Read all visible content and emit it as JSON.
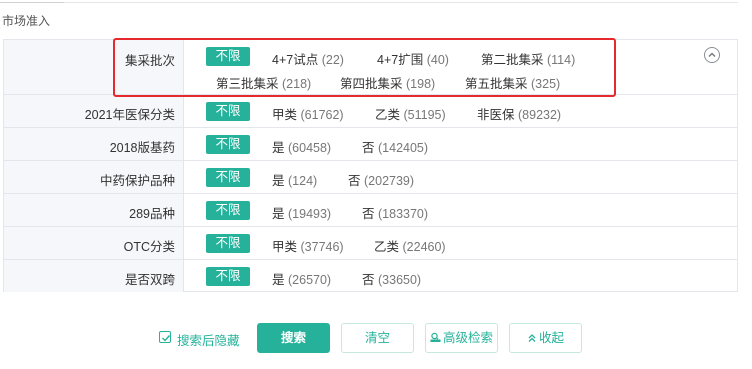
{
  "section": {
    "title": "市场准入"
  },
  "filters": [
    {
      "label": "集采批次",
      "unlimited": "不限",
      "options": [
        {
          "name": "4+7试点",
          "count": "(22)"
        },
        {
          "name": "4+7扩围",
          "count": "(40)"
        },
        {
          "name": "第二批集采",
          "count": "(114)"
        },
        {
          "name": "第三批集采",
          "count": "(218)"
        },
        {
          "name": "第四批集采",
          "count": "(198)"
        },
        {
          "name": "第五批集采",
          "count": "(325)"
        }
      ]
    },
    {
      "label": "2021年医保分类",
      "unlimited": "不限",
      "options": [
        {
          "name": "甲类",
          "count": "(61762)"
        },
        {
          "name": "乙类",
          "count": "(51195)"
        },
        {
          "name": "非医保",
          "count": "(89232)"
        }
      ]
    },
    {
      "label": "2018版基药",
      "unlimited": "不限",
      "options": [
        {
          "name": "是",
          "count": "(60458)"
        },
        {
          "name": "否",
          "count": "(142405)"
        }
      ]
    },
    {
      "label": "中药保护品种",
      "unlimited": "不限",
      "options": [
        {
          "name": "是",
          "count": "(124)"
        },
        {
          "name": "否",
          "count": "(202739)"
        }
      ]
    },
    {
      "label": "289品种",
      "unlimited": "不限",
      "options": [
        {
          "name": "是",
          "count": "(19493)"
        },
        {
          "name": "否",
          "count": "(183370)"
        }
      ]
    },
    {
      "label": "OTC分类",
      "unlimited": "不限",
      "options": [
        {
          "name": "甲类",
          "count": "(37746)"
        },
        {
          "name": "乙类",
          "count": "(22460)"
        }
      ]
    },
    {
      "label": "是否双跨",
      "unlimited": "不限",
      "options": [
        {
          "name": "是",
          "count": "(26570)"
        },
        {
          "name": "否",
          "count": "(33650)"
        }
      ]
    }
  ],
  "controls": {
    "hide_after_search": "搜索后隐藏",
    "search": "搜索",
    "clear": "清空",
    "advanced_search": "高级检索",
    "collapse": "收起"
  },
  "colors": {
    "accent": "#26b29a",
    "highlight_box": "#e5292c",
    "label_background": "#f5f7fa"
  },
  "icons": [
    "chevron-up-circle-icon",
    "checkbox-checked-icon",
    "advanced-search-icon",
    "double-chevron-up-icon"
  ]
}
